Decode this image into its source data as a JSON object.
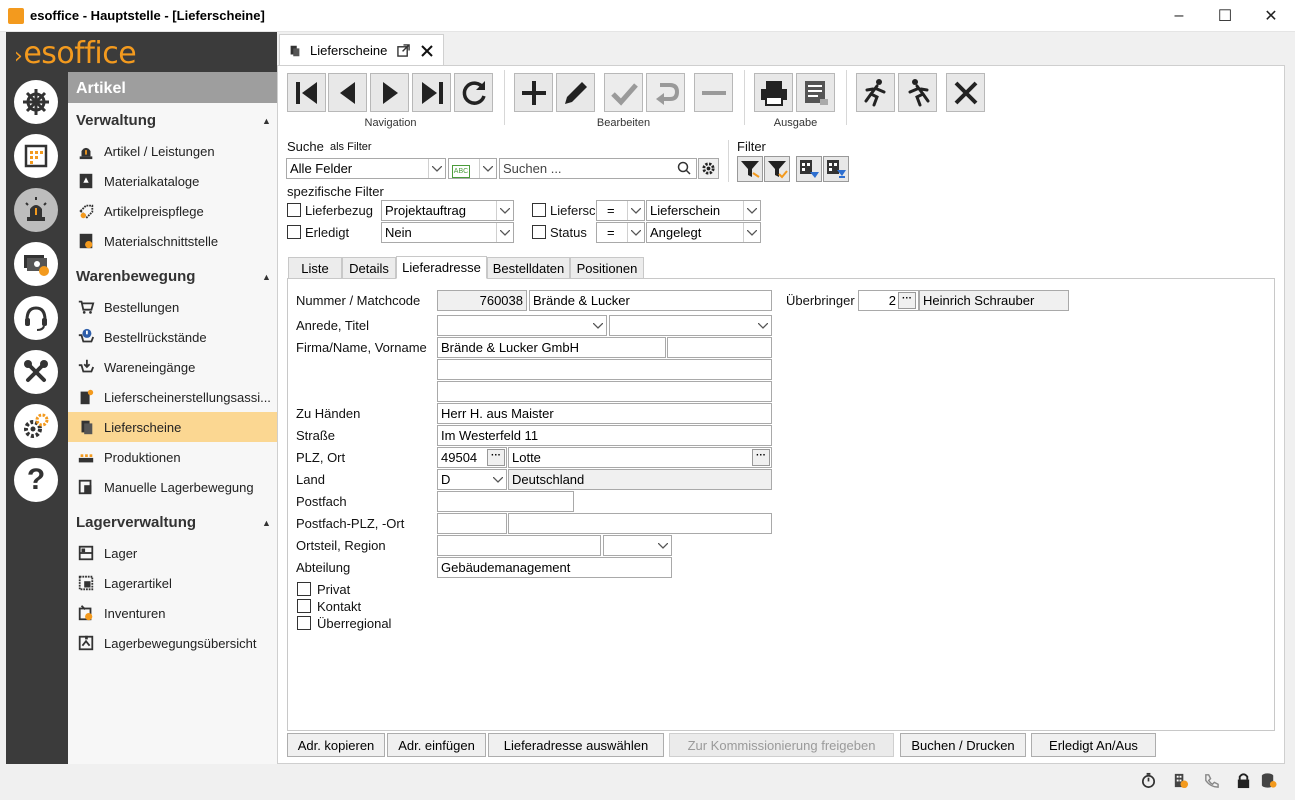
{
  "window": {
    "title": "esoffice - Hauptstelle - [Lieferscheine]",
    "minimize": "–",
    "maximize": "☐",
    "close": "✕"
  },
  "logo": {
    "chevron": "›",
    "text": "esoffice"
  },
  "colors": {
    "accent": "#f39a1e",
    "rail": "#3b3b3b",
    "active_item": "#fbd792",
    "nav_header": "#9e9e9e"
  },
  "rail": {
    "icons": [
      "helm-icon",
      "calendar-icon",
      "alarm-light-icon",
      "cash-icon",
      "headset-icon",
      "tools-icon",
      "gears-icon",
      "help-icon"
    ]
  },
  "help_glyph": "?",
  "nav": {
    "header": "Artikel",
    "groups": [
      {
        "title": "Verwaltung",
        "items": [
          "Artikel / Leistungen",
          "Materialkataloge",
          "Artikelpreispflege",
          "Materialschnittstelle"
        ]
      },
      {
        "title": "Warenbewegung",
        "items": [
          "Bestellungen",
          "Bestellrückstände",
          "Wareneingänge",
          "Lieferscheinerstellungsassi...",
          "Lieferscheine",
          "Produktionen",
          "Manuelle Lagerbewegung"
        ]
      },
      {
        "title": "Lagerverwaltung",
        "items": [
          "Lager",
          "Lagerartikel",
          "Inventuren",
          "Lagerbewegungsübersicht"
        ]
      }
    ],
    "active": "Lieferscheine"
  },
  "doc_tab": {
    "label": "Lieferscheine"
  },
  "toolbar": {
    "navigation_label": "Navigation",
    "bearbeiten_label": "Bearbeiten",
    "ausgabe_label": "Ausgabe"
  },
  "search": {
    "label": "Suche",
    "as_filter": "als Filter",
    "field_select": "Alle Felder",
    "placeholder": "Suchen ...",
    "filter_label": "Filter",
    "specific_filter": "spezifische Filter"
  },
  "filters": {
    "lieferbezug": {
      "label": "Lieferbezug",
      "value": "Projektauftrag"
    },
    "erledigt": {
      "label": "Erledigt",
      "value": "Nein"
    },
    "lieferschein": {
      "label": "Lieferschein",
      "op": "=",
      "value": "Lieferschein"
    },
    "status": {
      "label": "Status",
      "op": "=",
      "value": "Angelegt"
    }
  },
  "form_tabs": [
    "Liste",
    "Details",
    "Lieferadresse",
    "Bestelldaten",
    "Positionen"
  ],
  "form": {
    "nummer_label": "Nummer / Matchcode",
    "nummer": "760038",
    "matchcode": "Brände & Lucker",
    "ueberbringer_label": "Überbringer",
    "ueberbringer_nr": "2",
    "ueberbringer_name": "Heinrich Schrauber",
    "anrede_label": "Anrede, Titel",
    "firma_label": "Firma/Name, Vorname",
    "firma": "Brände & Lucker GmbH",
    "zuhaenden_label": "Zu Händen",
    "zuhaenden": "Herr H. aus  Maister",
    "strasse_label": "Straße",
    "strasse": "Im Westerfeld 11",
    "plz_label": "PLZ, Ort",
    "plz": "49504",
    "ort": "Lotte",
    "land_label": "Land",
    "land_code": "D",
    "land": "Deutschland",
    "postfach_label": "Postfach",
    "postfach_plz_label": "Postfach-PLZ, -Ort",
    "ortsteil_label": "Ortsteil, Region",
    "abteilung_label": "Abteilung",
    "abteilung": "Gebäudemanagement",
    "privat_label": "Privat",
    "kontakt_label": "Kontakt",
    "ueberregional_label": "Überregional",
    "dots": "···"
  },
  "bottom_buttons": {
    "adr_kopieren": "Adr. kopieren",
    "adr_einfuegen": "Adr. einfügen",
    "auswaehlen": "Lieferadresse auswählen",
    "kommissionierung": "Zur Kommissionierung freigeben",
    "buchen": "Buchen / Drucken",
    "erledigt": "Erledigt An/Aus"
  }
}
